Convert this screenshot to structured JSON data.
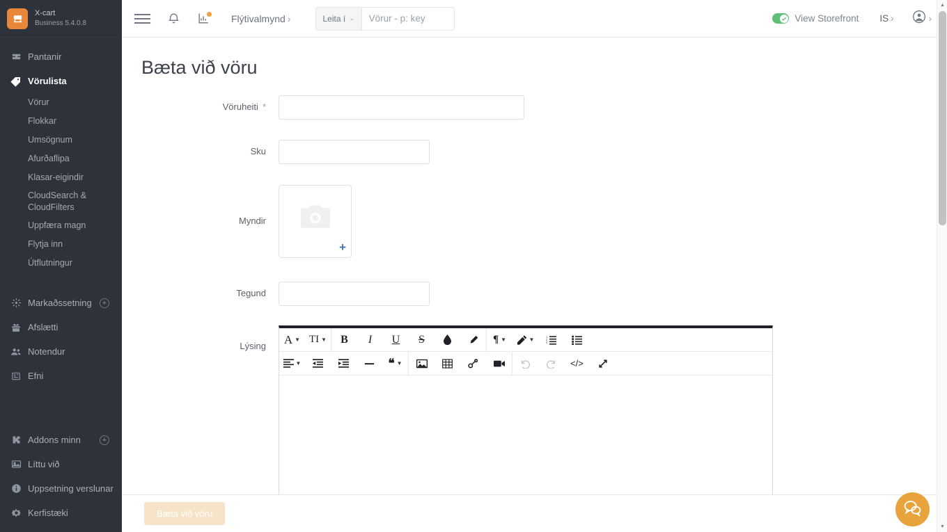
{
  "brand": {
    "name": "X-cart",
    "version": "Business 5.4.0.8",
    "logo_icon": "shopping-cart-icon"
  },
  "sidebar": {
    "items": [
      {
        "label": "Pantanir",
        "icon": "orders-inbox-icon",
        "active": false,
        "has_plus": false
      },
      {
        "label": "Vörulista",
        "icon": "tag-icon",
        "active": true,
        "has_plus": false
      },
      {
        "label": "Markaðssetning",
        "icon": "marketing-star-icon",
        "active": false,
        "has_plus": true
      },
      {
        "label": "Afslætti",
        "icon": "gift-icon",
        "active": false,
        "has_plus": false
      },
      {
        "label": "Notendur",
        "icon": "users-icon",
        "active": false,
        "has_plus": false
      },
      {
        "label": "Efni",
        "icon": "content-page-icon",
        "active": false,
        "has_plus": false
      },
      {
        "label": "Addons minn",
        "icon": "puzzle-icon",
        "active": false,
        "has_plus": true
      },
      {
        "label": "Líttu við",
        "icon": "look-image-icon",
        "active": false,
        "has_plus": false
      },
      {
        "label": "Uppsetning verslunar",
        "icon": "info-circle-icon",
        "active": false,
        "has_plus": false
      },
      {
        "label": "Kerfistæki",
        "icon": "gear-icon",
        "active": false,
        "has_plus": false
      }
    ],
    "subitems": [
      {
        "label": "Vörur"
      },
      {
        "label": "Flokkar"
      },
      {
        "label": "Umsögnum"
      },
      {
        "label": "Afurðaflipa"
      },
      {
        "label": "Klasar-eigindir"
      },
      {
        "label": "CloudSearch & CloudFilters"
      },
      {
        "label": "Uppfæra magn"
      },
      {
        "label": "Flytja inn"
      },
      {
        "label": "Útflutningur"
      }
    ]
  },
  "header": {
    "hamburger_icon": "hamburger-menu-icon",
    "bell_icon": "notification-bell-icon",
    "stats_icon": "statistics-chart-icon",
    "stats_badge": true,
    "quickmenu_label": "Flýtivalmynd",
    "quickmenu_chevron": "›",
    "search": {
      "scope_label": "Leita í",
      "scope_chevron": "⌄",
      "placeholder": "Vörur - p: key",
      "value": ""
    },
    "storefront_label": "View Storefront",
    "storefront_enabled": true,
    "storefront_toggle_icon": "check-circle-icon",
    "language": "IS",
    "language_chevron": "›",
    "account_icon": "user-avatar-icon",
    "account_chevron": "›"
  },
  "main": {
    "page_title": "Bæta við vöru",
    "fields": [
      {
        "label": "Vöruheiti",
        "required": true,
        "required_mark": "*",
        "value": "",
        "size": "wide"
      },
      {
        "label": "Sku",
        "required": false,
        "required_mark": "",
        "value": "",
        "size": "mid"
      }
    ],
    "images_label": "Myndir",
    "images_placeholder_icon": "camera-icon",
    "images_add_icon": "plus-icon",
    "images_add_label": "+",
    "type_field": {
      "label": "Tegund",
      "value": "",
      "size": "mid"
    },
    "description_label": "Lýsing",
    "editor": {
      "toolbar_row1": [
        {
          "group": 0,
          "icon": "font-family-icon",
          "glyph": "A",
          "caret": true
        },
        {
          "group": 0,
          "icon": "font-size-icon",
          "glyph": "TI",
          "caret": true
        },
        {
          "group": 1,
          "icon": "bold-icon",
          "glyph": "B",
          "caret": false
        },
        {
          "group": 1,
          "icon": "italic-icon",
          "glyph": "I",
          "caret": false
        },
        {
          "group": 1,
          "icon": "underline-icon",
          "glyph": "U",
          "caret": false
        },
        {
          "group": 1,
          "icon": "strikethrough-icon",
          "glyph": "S",
          "caret": false
        },
        {
          "group": 1,
          "icon": "text-color-icon",
          "glyph": "◆",
          "caret": false
        },
        {
          "group": 1,
          "icon": "clear-format-icon",
          "glyph": "◣",
          "caret": false
        },
        {
          "group": 2,
          "icon": "paragraph-format-icon",
          "glyph": "¶",
          "caret": true
        },
        {
          "group": 2,
          "icon": "paragraph-style-icon",
          "glyph": "✎",
          "caret": true
        },
        {
          "group": 2,
          "icon": "ordered-list-icon",
          "glyph": "≣",
          "caret": false
        },
        {
          "group": 2,
          "icon": "unordered-list-icon",
          "glyph": "☰",
          "caret": false
        }
      ],
      "toolbar_row2": [
        {
          "group": 0,
          "icon": "align-icon",
          "glyph": "≡",
          "caret": true,
          "disabled": false
        },
        {
          "group": 0,
          "icon": "outdent-icon",
          "glyph": "⇤",
          "caret": false,
          "disabled": false
        },
        {
          "group": 0,
          "icon": "indent-icon",
          "glyph": "⇥",
          "caret": false,
          "disabled": false
        },
        {
          "group": 0,
          "icon": "horizontal-rule-icon",
          "glyph": "—",
          "caret": false,
          "disabled": false
        },
        {
          "group": 0,
          "icon": "quote-icon",
          "glyph": "❝",
          "caret": true,
          "disabled": false
        },
        {
          "group": 1,
          "icon": "insert-image-icon",
          "glyph": "▨",
          "caret": false,
          "disabled": false
        },
        {
          "group": 1,
          "icon": "insert-table-icon",
          "glyph": "▦",
          "caret": false,
          "disabled": false
        },
        {
          "group": 1,
          "icon": "insert-link-icon",
          "glyph": "🔗",
          "caret": false,
          "disabled": false
        },
        {
          "group": 1,
          "icon": "insert-video-icon",
          "glyph": "▶",
          "caret": false,
          "disabled": false
        },
        {
          "group": 2,
          "icon": "undo-icon",
          "glyph": "↺",
          "caret": false,
          "disabled": true
        },
        {
          "group": 2,
          "icon": "redo-icon",
          "glyph": "↻",
          "caret": false,
          "disabled": true
        },
        {
          "group": 2,
          "icon": "code-view-icon",
          "glyph": "</>",
          "caret": false,
          "disabled": false
        },
        {
          "group": 2,
          "icon": "fullscreen-icon",
          "glyph": "⤢",
          "caret": false,
          "disabled": false
        }
      ],
      "body_value": ""
    }
  },
  "footer": {
    "save_label": "Bæta við vöru",
    "save_disabled": true
  },
  "chat": {
    "icon": "chat-bubbles-icon"
  },
  "scrollbar": {
    "up_arrow": "▲",
    "down_arrow": "▼"
  },
  "colors": {
    "sidebar_bg": "#2d323b",
    "brand_orange": "#e8863a",
    "accent_blue": "#3d72b8",
    "toggle_green": "#5fbf74",
    "save_disabled_bg": "#f7e4c8",
    "chat_orange": "#e8a33d",
    "editor_topbar": "#1d2126"
  }
}
